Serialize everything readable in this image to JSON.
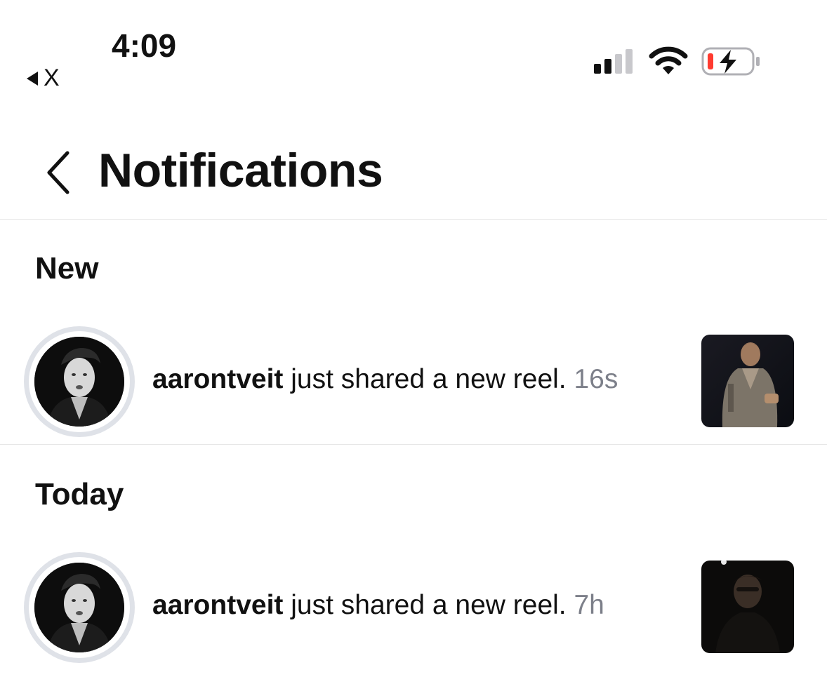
{
  "status_bar": {
    "time": "4:09",
    "back_app": "X",
    "battery_color": "#ff3b30"
  },
  "header": {
    "title": "Notifications"
  },
  "sections": [
    {
      "label": "New",
      "items": [
        {
          "username": "aarontveit",
          "message": "just shared a new reel.",
          "time": "16s"
        }
      ]
    },
    {
      "label": "Today",
      "items": [
        {
          "username": "aarontveit",
          "message": "just shared a new reel.",
          "time": "7h"
        }
      ]
    }
  ]
}
